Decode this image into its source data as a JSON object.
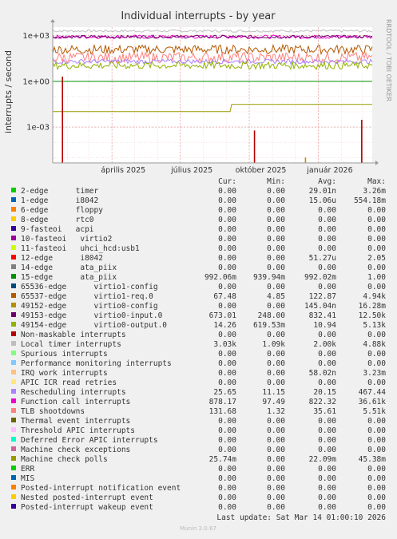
{
  "chart_data": {
    "type": "line",
    "title": "Individual interrupts - by year",
    "ylabel": "interrupts / second",
    "yscale": "log",
    "y_ticks": [
      {
        "value": 1000,
        "label": "1e+03"
      },
      {
        "value": 1,
        "label": "1e+00"
      },
      {
        "value": 0.001,
        "label": "1e-03"
      }
    ],
    "x_ticks": [
      "április 2025",
      "július 2025",
      "október 2025",
      "január 2026"
    ],
    "watermark": "RRDTOOL / TOBI OETIKER",
    "columns": [
      "Cur:",
      "Min:",
      "Avg:",
      "Max:"
    ],
    "series": [
      {
        "name": "2-edge      timer",
        "color": "#00cc00",
        "cur": "0.00",
        "min": "0.00",
        "avg": "29.01n",
        "max": "3.26m"
      },
      {
        "name": "1-edge      i8042",
        "color": "#0066b3",
        "cur": "0.00",
        "min": "0.00",
        "avg": "15.06u",
        "max": "554.18m"
      },
      {
        "name": "6-edge      floppy",
        "color": "#ff8000",
        "cur": "0.00",
        "min": "0.00",
        "avg": "0.00",
        "max": "0.00"
      },
      {
        "name": "8-edge      rtc0",
        "color": "#ffcc00",
        "cur": "0.00",
        "min": "0.00",
        "avg": "0.00",
        "max": "0.00"
      },
      {
        "name": "9-fasteoi   acpi",
        "color": "#330099",
        "cur": "0.00",
        "min": "0.00",
        "avg": "0.00",
        "max": "0.00"
      },
      {
        "name": "10-fasteoi   virtio2",
        "color": "#990099",
        "cur": "0.00",
        "min": "0.00",
        "avg": "0.00",
        "max": "0.00"
      },
      {
        "name": "11-fasteoi   uhci_hcd:usb1",
        "color": "#ccff00",
        "cur": "0.00",
        "min": "0.00",
        "avg": "0.00",
        "max": "0.00"
      },
      {
        "name": "12-edge      i8042",
        "color": "#ff0000",
        "cur": "0.00",
        "min": "0.00",
        "avg": "51.27u",
        "max": "2.05"
      },
      {
        "name": "14-edge      ata_piix",
        "color": "#808080",
        "cur": "0.00",
        "min": "0.00",
        "avg": "0.00",
        "max": "0.00"
      },
      {
        "name": "15-edge      ata_piix",
        "color": "#008f00",
        "cur": "992.06m",
        "min": "939.94m",
        "avg": "992.02m",
        "max": "1.00"
      },
      {
        "name": "65536-edge      virtio1-config",
        "color": "#00487d",
        "cur": "0.00",
        "min": "0.00",
        "avg": "0.00",
        "max": "0.00"
      },
      {
        "name": "65537-edge      virtio1-req.0",
        "color": "#b35a00",
        "cur": "67.48",
        "min": "4.85",
        "avg": "122.87",
        "max": "4.94k"
      },
      {
        "name": "49152-edge      virtio0-config",
        "color": "#b38f00",
        "cur": "0.00",
        "min": "0.00",
        "avg": "145.04n",
        "max": "16.28m"
      },
      {
        "name": "49153-edge      virtio0-input.0",
        "color": "#6b006b",
        "cur": "673.01",
        "min": "248.00",
        "avg": "832.41",
        "max": "12.50k"
      },
      {
        "name": "49154-edge      virtio0-output.0",
        "color": "#8fb300",
        "cur": "14.26",
        "min": "619.53m",
        "avg": "10.94",
        "max": "5.13k"
      },
      {
        "name": "Non-maskable interrupts",
        "color": "#b30000",
        "cur": "0.00",
        "min": "0.00",
        "avg": "0.00",
        "max": "0.00"
      },
      {
        "name": "Local timer interrupts",
        "color": "#bebebe",
        "cur": "3.03k",
        "min": "1.09k",
        "avg": "2.00k",
        "max": "4.88k"
      },
      {
        "name": "Spurious interrupts",
        "color": "#80ff80",
        "cur": "0.00",
        "min": "0.00",
        "avg": "0.00",
        "max": "0.00"
      },
      {
        "name": "Performance monitoring interrupts",
        "color": "#80c9ff",
        "cur": "0.00",
        "min": "0.00",
        "avg": "0.00",
        "max": "0.00"
      },
      {
        "name": "IRQ work interrupts",
        "color": "#ffc080",
        "cur": "0.00",
        "min": "0.00",
        "avg": "58.02n",
        "max": "3.23m"
      },
      {
        "name": "APIC ICR read retries",
        "color": "#ffe680",
        "cur": "0.00",
        "min": "0.00",
        "avg": "0.00",
        "max": "0.00"
      },
      {
        "name": "Rescheduling interrupts",
        "color": "#aa80ff",
        "cur": "25.65",
        "min": "11.15",
        "avg": "20.15",
        "max": "467.44"
      },
      {
        "name": "Function call interrupts",
        "color": "#ee00cc",
        "cur": "878.17",
        "min": "97.49",
        "avg": "822.32",
        "max": "36.61k"
      },
      {
        "name": "TLB shootdowns",
        "color": "#ff8080",
        "cur": "131.68",
        "min": "1.32",
        "avg": "35.61",
        "max": "5.51k"
      },
      {
        "name": "Thermal event interrupts",
        "color": "#666600",
        "cur": "0.00",
        "min": "0.00",
        "avg": "0.00",
        "max": "0.00"
      },
      {
        "name": "Threshold APIC interrupts",
        "color": "#ffbfff",
        "cur": "0.00",
        "min": "0.00",
        "avg": "0.00",
        "max": "0.00"
      },
      {
        "name": "Deferred Error APIC interrupts",
        "color": "#00ffcc",
        "cur": "0.00",
        "min": "0.00",
        "avg": "0.00",
        "max": "0.00"
      },
      {
        "name": "Machine check exceptions",
        "color": "#cc6699",
        "cur": "0.00",
        "min": "0.00",
        "avg": "0.00",
        "max": "0.00"
      },
      {
        "name": "Machine check polls",
        "color": "#999900",
        "cur": "25.74m",
        "min": "0.00",
        "avg": "22.09m",
        "max": "45.38m"
      },
      {
        "name": "ERR",
        "color": "#00cc00",
        "cur": "0.00",
        "min": "0.00",
        "avg": "0.00",
        "max": "0.00"
      },
      {
        "name": "MIS",
        "color": "#0066b3",
        "cur": "0.00",
        "min": "0.00",
        "avg": "0.00",
        "max": "0.00"
      },
      {
        "name": "Posted-interrupt notification event",
        "color": "#ff8000",
        "cur": "0.00",
        "min": "0.00",
        "avg": "0.00",
        "max": "0.00"
      },
      {
        "name": "Nested posted-interrupt event",
        "color": "#ffcc00",
        "cur": "0.00",
        "min": "0.00",
        "avg": "0.00",
        "max": "0.00"
      },
      {
        "name": "Posted-interrupt wakeup event",
        "color": "#330099",
        "cur": "0.00",
        "min": "0.00",
        "avg": "0.00",
        "max": "0.00"
      }
    ],
    "traces": [
      {
        "name": "Local timer interrupts",
        "color": "#bebebe",
        "level": 2000,
        "spread": 0.08
      },
      {
        "name": "Function call interrupts",
        "color": "#ee00cc",
        "level": 822,
        "spread": 0.12
      },
      {
        "name": "49153-edge      virtio0-input.0",
        "color": "#6b006b",
        "level": 832,
        "spread": 0.1
      },
      {
        "name": "65537-edge      virtio1-req.0",
        "color": "#b35a00",
        "level": 123,
        "spread": 0.3
      },
      {
        "name": "TLB shootdowns",
        "color": "#ff8080",
        "level": 36,
        "spread": 0.35
      },
      {
        "name": "Rescheduling interrupts",
        "color": "#aa80ff",
        "level": 20,
        "spread": 0.15
      },
      {
        "name": "49154-edge      virtio0-output.0",
        "color": "#8fb300",
        "level": 11,
        "spread": 0.25
      },
      {
        "name": "15-edge      ata_piix",
        "color": "#008f00",
        "level": 0.992,
        "spread": 0
      },
      {
        "name": "Machine check polls",
        "color": "#999900",
        "level": 0.022,
        "spread": 0
      }
    ],
    "spikes": [
      {
        "name": "12-edge      i8042",
        "color": "#b30000",
        "date": "2025-01-25",
        "value": 2.05
      },
      {
        "name": "12-edge      i8042",
        "color": "#b30000",
        "date": "2025-10-08",
        "value": 0.0006
      },
      {
        "name": "12-edge      i8042",
        "color": "#b30000",
        "date": "2026-02-28",
        "value": 0.003
      },
      {
        "name": "49152-edge      virtio0-config",
        "color": "#b38f00",
        "date": "2025-12-15",
        "value": 1e-05
      }
    ]
  },
  "footer": {
    "last_update": "Last update: Sat Mar 14 01:00:10 2026",
    "munin": "Munin 2.0.67"
  }
}
